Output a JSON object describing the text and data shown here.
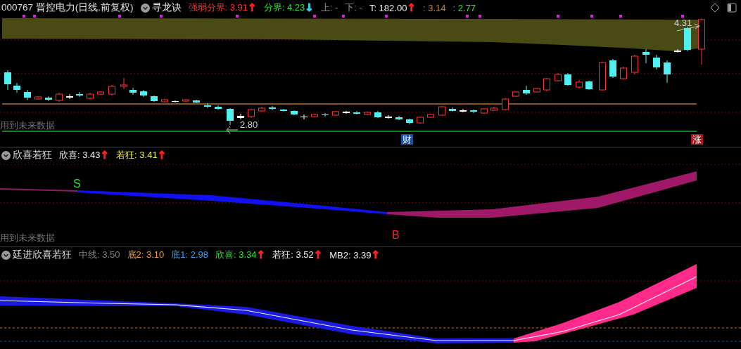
{
  "main_pane": {
    "code": "000767",
    "name": "晋控电力(日线.前复权)",
    "indicator": "寻龙诀",
    "readings": [
      {
        "text": "强弱分界: 3.91",
        "color": "#ff3030",
        "arrow": {
          "symbol": "↑",
          "color": "#ff2020"
        }
      },
      {
        "text": "分界: 4.23",
        "color": "#30e030",
        "arrow": {
          "symbol": "↓",
          "color": "#30d0e0"
        }
      },
      {
        "text": "上: -",
        "color": "#909090"
      },
      {
        "text": "下: -",
        "color": "#909090"
      },
      {
        "text": "T: 182.00",
        "color": "#f0f0f0",
        "arrow": {
          "symbol": "↑",
          "color": "#ff2020"
        }
      },
      {
        "text": ": 3.14",
        "color": "#d08030"
      },
      {
        "text": ": 2.77",
        "color": "#30e030"
      }
    ],
    "annotations": [
      {
        "text": "4.31",
        "kind": "price"
      },
      {
        "text": "2.80",
        "kind": "price"
      },
      {
        "text": "用到未来数据",
        "kind": "warning"
      },
      {
        "text": "财",
        "kind": "badge-blue"
      },
      {
        "text": "涨",
        "kind": "badge-red"
      }
    ]
  },
  "pane_2": {
    "indicator": "欣喜若狂",
    "readings": [
      {
        "text": "欣喜: 3.43",
        "color": "#f0f0f0",
        "arrow": {
          "symbol": "↑",
          "color": "#ff2020"
        }
      },
      {
        "text": "若狂: 3.41",
        "color": "#f0f040",
        "arrow": {
          "symbol": "↑",
          "color": "#ff2020"
        }
      }
    ],
    "annotations": [
      {
        "text": "S",
        "kind": "signal-green"
      },
      {
        "text": "用到未来数据",
        "kind": "warning"
      },
      {
        "text": "B",
        "kind": "signal-red"
      }
    ]
  },
  "pane_3": {
    "indicator": "廷进欣喜若狂",
    "readings": [
      {
        "text": "中线: 3.50",
        "color": "#808080"
      },
      {
        "text": "底2: 3.10",
        "color": "#f0a030"
      },
      {
        "text": "底1: 2.98",
        "color": "#30a0f0"
      },
      {
        "text": "欣喜: 3.34",
        "color": "#30e030",
        "arrow": {
          "symbol": "↑",
          "color": "#ff2020"
        }
      },
      {
        "text": "若狂: 3.52",
        "color": "#f0f0f0",
        "arrow": {
          "symbol": "↑",
          "color": "#ff2020"
        }
      },
      {
        "text": "MB2: 3.39",
        "color": "#f0f0f0",
        "arrow": {
          "symbol": "↑",
          "color": "#ff2020"
        }
      }
    ]
  }
}
